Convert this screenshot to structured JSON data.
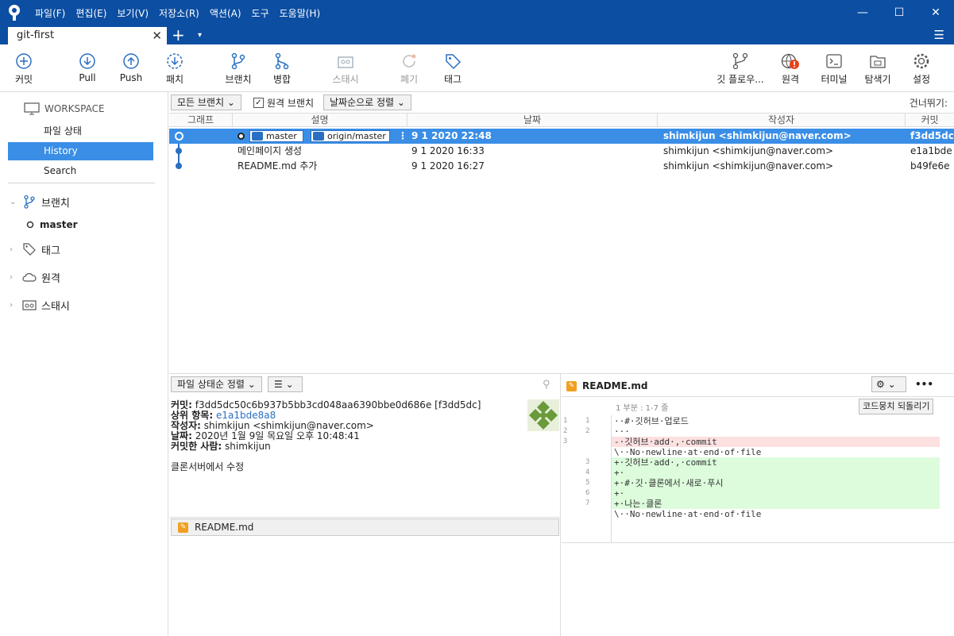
{
  "menu": [
    "파일(F)",
    "편집(E)",
    "보기(V)",
    "저장소(R)",
    "액션(A)",
    "도구",
    "도움말(H)"
  ],
  "window": {
    "min": "—",
    "max": "☐",
    "close": "✕"
  },
  "tab": {
    "title": "git-first",
    "close": "✕",
    "add": "+",
    "dropdown": "▾",
    "menu": "☰"
  },
  "toolbar": {
    "commit": "커밋",
    "pull": "Pull",
    "push": "Push",
    "fetch": "패치",
    "branch": "브랜치",
    "merge": "병합",
    "stash": "스태시",
    "discard": "폐기",
    "tag": "태그",
    "flow": "깃 플로우...",
    "remote": "원격",
    "terminal": "터미널",
    "explorer": "탐색기",
    "settings": "설정"
  },
  "sidebar": {
    "workspace": "WORKSPACE",
    "items": [
      "파일 상태",
      "History",
      "Search"
    ],
    "branches": "브랜치",
    "branch_master": "master",
    "tags": "태그",
    "remotes": "원격",
    "stashes": "스태시"
  },
  "filter": {
    "all_branches": "모든 브랜치",
    "remote_branches": "원격 브랜치",
    "sort": "날짜순으로 정렬",
    "skip": "건너뛰기:"
  },
  "columns": {
    "graph": "그래프",
    "desc": "설명",
    "date": "날짜",
    "author": "작성자",
    "commit": "커밋"
  },
  "commits": [
    {
      "tag1": "master",
      "tag2": "origin/master",
      "date": "9 1 2020 22:48",
      "author": "shimkijun <shimkijun@naver.com>",
      "hash": "f3dd5dc"
    },
    {
      "desc": "메인페이지 생성",
      "date": "9 1 2020 16:33",
      "author": "shimkijun <shimkijun@naver.com>",
      "hash": "e1a1bde"
    },
    {
      "desc": "README.md 추가",
      "date": "9 1 2020 16:27",
      "author": "shimkijun <shimkijun@naver.com>",
      "hash": "b49fe6e"
    }
  ],
  "details": {
    "sort": "파일 상태순 정렬",
    "commit_label": "커밋:",
    "commit_value": "f3dd5dc50c6b937b5bb3cd048aa6390bbe0d686e [f3dd5dc]",
    "parent_label": "상위 항목:",
    "parent_value": "e1a1bde8a8",
    "author_label": "작성자:",
    "author_value": "shimkijun <shimkijun@naver.com>",
    "date_label": "날짜:",
    "date_value": "2020년 1월 9일 목요일 오후 10:48:41",
    "committer_label": "커밋한 사람:",
    "committer_value": "shimkijun",
    "message": "클론서버에서 수정",
    "file": "README.md"
  },
  "diff": {
    "file": "README.md",
    "hunk": "1 부분 : 1-7 줄",
    "revert": "코드뭉치 되돌리기",
    "more": "•••",
    "lines": [
      {
        "o": "1",
        "n": "1",
        "t": "··#·깃허브·업로드",
        "k": ""
      },
      {
        "o": "2",
        "n": "2",
        "t": "···",
        "k": ""
      },
      {
        "o": "3",
        "n": "",
        "t": "-·깃허브·add·,·commit",
        "k": "del"
      },
      {
        "o": "",
        "n": "",
        "t": "\\··No·newline·at·end·of·file",
        "k": ""
      },
      {
        "o": "",
        "n": "3",
        "t": "+·깃허브·add·,·commit",
        "k": "add"
      },
      {
        "o": "",
        "n": "4",
        "t": "+·",
        "k": "add"
      },
      {
        "o": "",
        "n": "5",
        "t": "+·#·깃·클론에서·새로·푸시",
        "k": "add"
      },
      {
        "o": "",
        "n": "6",
        "t": "+·",
        "k": "add"
      },
      {
        "o": "",
        "n": "7",
        "t": "+·나는·클론",
        "k": "add"
      },
      {
        "o": "",
        "n": "",
        "t": "\\··No·newline·at·end·of·file",
        "k": ""
      }
    ]
  },
  "colors": {
    "brand": "#0b4ea2",
    "selection": "#3a8ee6",
    "branch": "#2a6fc2",
    "warn": "#e8421c"
  }
}
